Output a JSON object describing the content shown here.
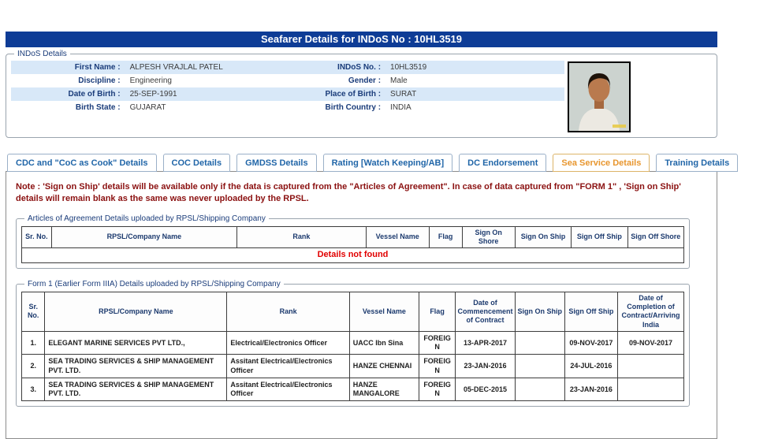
{
  "header": {
    "title": "Seafarer Details for INDoS No : 10HL3519"
  },
  "indos_details": {
    "legend": "INDoS Details",
    "rows": [
      {
        "label1": "First Name :",
        "value1": "ALPESH VRAJLAL PATEL",
        "label2": "INDoS No. :",
        "value2": "10HL3519"
      },
      {
        "label1": "Discipline :",
        "value1": "Engineering",
        "label2": "Gender :",
        "value2": "Male"
      },
      {
        "label1": "Date of Birth :",
        "value1": "25-SEP-1991",
        "label2": "Place of Birth :",
        "value2": "SURAT"
      },
      {
        "label1": "Birth State :",
        "value1": "GUJARAT",
        "label2": "Birth Country :",
        "value2": "INDIA"
      }
    ]
  },
  "tabs": [
    {
      "label": "CDC and \"CoC as Cook\" Details",
      "active": false
    },
    {
      "label": "COC Details",
      "active": false
    },
    {
      "label": "GMDSS Details",
      "active": false
    },
    {
      "label": "Rating [Watch Keeping/AB]",
      "active": false
    },
    {
      "label": "DC Endorsement",
      "active": false
    },
    {
      "label": "Sea Service Details",
      "active": true
    },
    {
      "label": "Training Details",
      "active": false
    }
  ],
  "note": {
    "prefix": "Note :",
    "text": "'Sign on Ship' details will be available only if the data is captured from the \"Articles of Agreement\". In case of data captured from \"FORM 1\" , 'Sign on Ship' details will remain blank as the same was never uploaded by the RPSL."
  },
  "articles_table": {
    "legend": "Articles of Agreement Details uploaded by RPSL/Shipping Company",
    "headers": [
      "Sr. No.",
      "RPSL/Company Name",
      "Rank",
      "Vessel Name",
      "Flag",
      "Sign On Shore",
      "Sign On Ship",
      "Sign Off Ship",
      "Sign Off Shore"
    ],
    "rows": [],
    "empty_message": "Details not found"
  },
  "form1_table": {
    "legend": "Form 1 (Earlier Form IIIA) Details uploaded by RPSL/Shipping Company",
    "headers": [
      "Sr. No.",
      "RPSL/Company Name",
      "Rank",
      "Vessel Name",
      "Flag",
      "Date of Commencement of Contract",
      "Sign On Ship",
      "Sign Off Ship",
      "Date of Completion of Contract/Arriving India"
    ],
    "rows": [
      [
        "1.",
        "ELEGANT MARINE SERVICES PVT LTD.,",
        "Electrical/Electronics Officer",
        "UACC Ibn Sina",
        "FOREIGN",
        "13-APR-2017",
        "",
        "09-NOV-2017",
        "09-NOV-2017"
      ],
      [
        "2.",
        "SEA TRADING SERVICES & SHIP MANAGEMENT PVT. LTD.",
        "Assitant Electrical/Electronics Officer",
        "HANZE CHENNAI",
        "FOREIGN",
        "23-JAN-2016",
        "",
        "24-JUL-2016",
        ""
      ],
      [
        "3.",
        "SEA TRADING SERVICES & SHIP MANAGEMENT PVT. LTD.",
        "Assitant Electrical/Electronics Officer",
        "HANZE MANGALORE",
        "FOREIGN",
        "05-DEC-2015",
        "",
        "23-JAN-2016",
        ""
      ]
    ],
    "empty_message": "Details not found"
  },
  "colors": {
    "header_bg": "#0e3c96",
    "header_text": "#ffffff",
    "label_color": "#1a3c7a",
    "row_alt_bg": "#d8e8f8",
    "tab_text": "#2166a8",
    "tab_active_text": "#e8962e",
    "note_color": "#8b1111",
    "table_header_text": "#1c3a6e",
    "empty_message_color": "#e10000"
  }
}
